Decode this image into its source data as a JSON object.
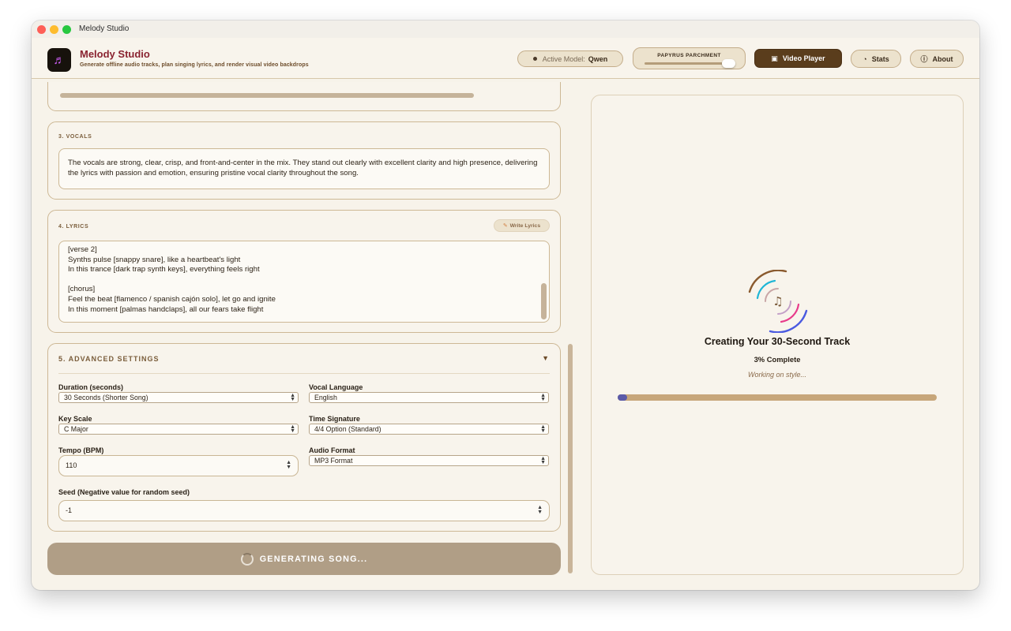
{
  "window": {
    "title": "Melody Studio"
  },
  "header": {
    "app_name": "Melody Studio",
    "tagline": "Generate offline audio tracks, plan singing lyrics, and render visual video backdrops",
    "active_model_label": "Active Model:",
    "active_model_value": "Qwen",
    "theme_label": "PAPYRUS PARCHMENT",
    "video_player_label": "Video Player",
    "stats_label": "Stats",
    "about_label": "About"
  },
  "vocals": {
    "section_label": "3. VOCALS",
    "text": "The vocals are strong, clear, crisp, and front-and-center in the mix. They stand out clearly with excellent clarity and high presence, delivering the lyrics with passion and emotion, ensuring pristine vocal clarity throughout the song."
  },
  "lyrics": {
    "section_label": "4. LYRICS",
    "write_button": "Write Lyrics",
    "lines": [
      "[verse 2]",
      "Synths pulse [snappy snare], like a heartbeat's light",
      "In this trance [dark trap synth keys], everything feels right",
      "",
      "[chorus]",
      "Feel the beat [flamenco / spanish cajón solo], let go and ignite",
      "In this moment [palmas handclaps], all our fears take flight"
    ]
  },
  "advanced": {
    "title": "5. ADVANCED SETTINGS",
    "duration": {
      "label": "Duration (seconds)",
      "value": "30 Seconds (Shorter Song)"
    },
    "vocal_language": {
      "label": "Vocal Language",
      "value": "English"
    },
    "key_scale": {
      "label": "Key Scale",
      "value": "C Major"
    },
    "time_signature": {
      "label": "Time Signature",
      "value": "4/4 Option (Standard)"
    },
    "tempo": {
      "label": "Tempo (BPM)",
      "value": "110"
    },
    "audio_format": {
      "label": "Audio Format",
      "value": "MP3 Format"
    },
    "seed": {
      "label": "Seed (Negative value for random seed)",
      "value": "-1"
    }
  },
  "generate_button": "GENERATING SONG...",
  "progress": {
    "title": "Creating Your 30-Second Track",
    "percent_text": "3% Complete",
    "status": "Working on style...",
    "fraction": 0.03
  },
  "colors": {
    "accent_brown": "#5a3d1c",
    "brand_red": "#8a2330",
    "parchment": "#f7f3ea",
    "progress_fill": "#5b5aa8"
  }
}
